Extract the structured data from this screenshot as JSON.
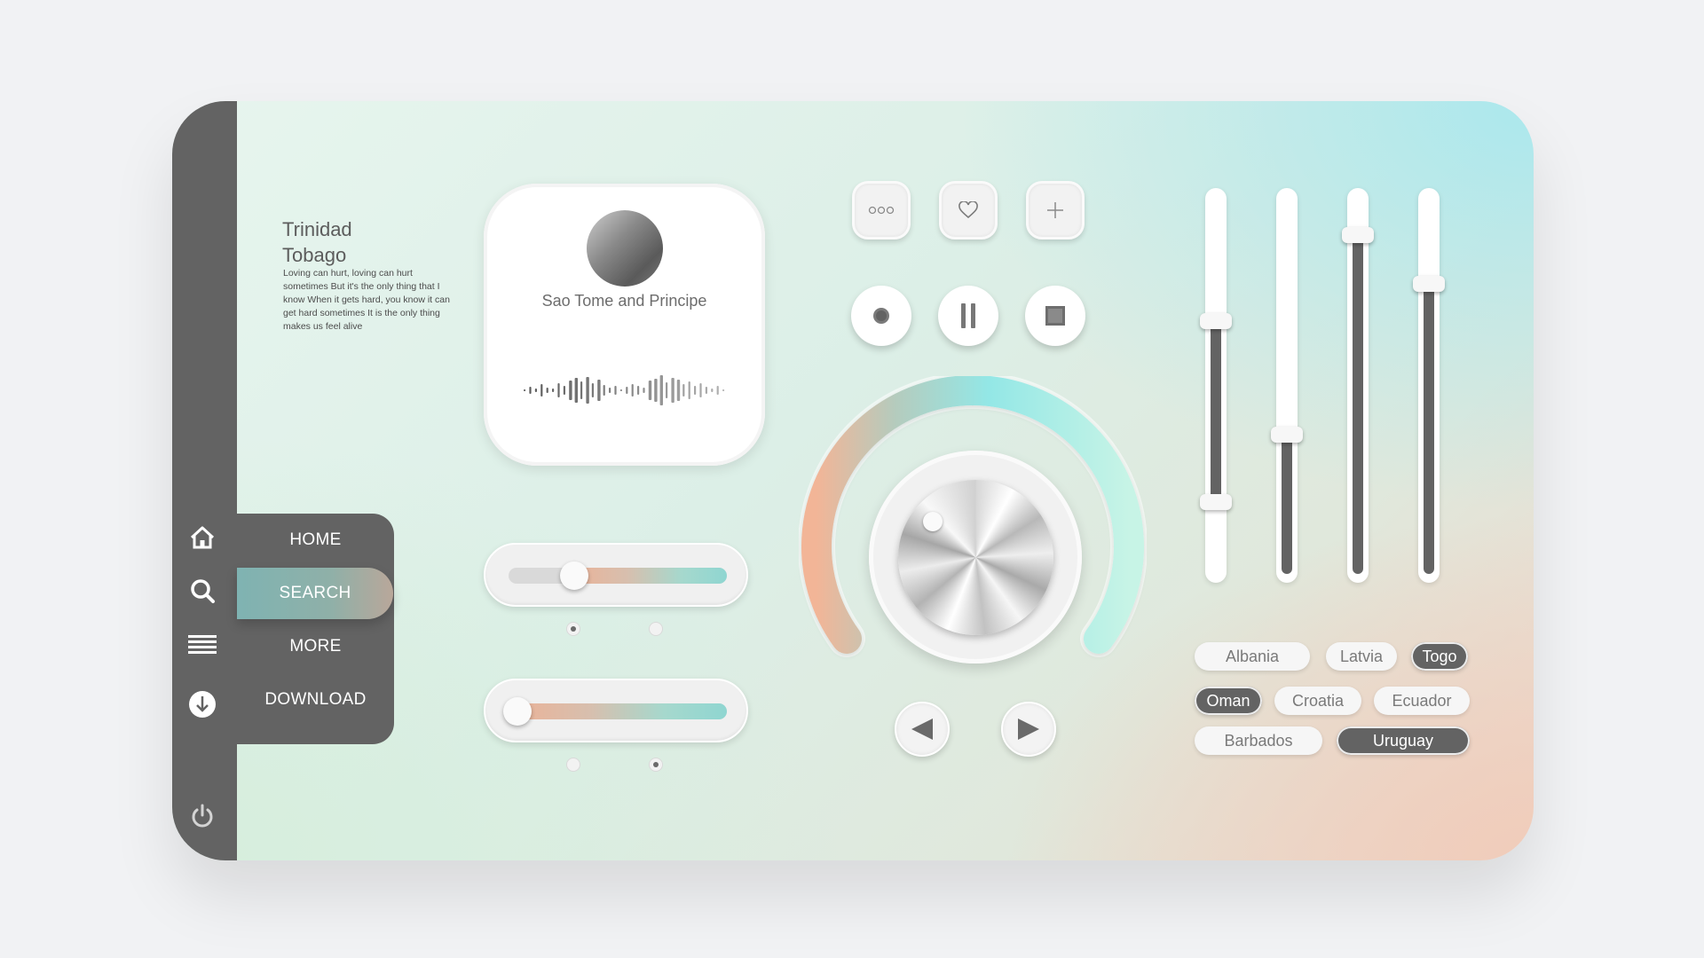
{
  "sidebar": {
    "icons": [
      {
        "icon": "home-icon"
      },
      {
        "icon": "search-icon"
      },
      {
        "icon": "menu-icon"
      },
      {
        "icon": "download-icon"
      }
    ],
    "power_icon": "power-icon"
  },
  "menu": {
    "items": [
      {
        "label": "HOME"
      },
      {
        "label": "SEARCH"
      },
      {
        "label": "MORE"
      },
      {
        "label": "DOWNLOAD"
      }
    ],
    "active_index": 1
  },
  "info": {
    "title_line1": "Trinidad",
    "title_line2": "Tobago",
    "lyrics": "Loving can hurt, loving can hurt sometimes But it's the only thing that I know When it gets hard, you know it can get hard sometimes It is the only thing makes us feel alive"
  },
  "player": {
    "title": "Sao Tome and Principe"
  },
  "sliders": [
    {
      "value_percent": 30
    },
    {
      "value_percent": 4
    }
  ],
  "slider_dots": [
    {
      "active": 0
    },
    {
      "active": 1
    }
  ],
  "controls": {
    "top_buttons": [
      "more-icon",
      "heart-icon",
      "plus-icon"
    ],
    "media_buttons": [
      "record-icon",
      "pause-icon",
      "stop-icon"
    ],
    "nav_buttons": [
      "previous-icon",
      "next-icon"
    ]
  },
  "colors": {
    "dark": "#636363",
    "accent_teal": "#8fd6d1",
    "accent_peach": "#eab399"
  },
  "vertical_sliders": [
    {
      "levels": [
        0.67,
        0.19
      ]
    },
    {
      "levels": [
        0.37
      ]
    },
    {
      "levels": [
        0.9
      ]
    },
    {
      "levels": [
        0.77
      ]
    }
  ],
  "tags": [
    {
      "label": "Albania",
      "style": "light"
    },
    {
      "label": "Latvia",
      "style": "light"
    },
    {
      "label": "Togo",
      "style": "dark"
    },
    {
      "label": "Oman",
      "style": "dark"
    },
    {
      "label": "Croatia",
      "style": "light"
    },
    {
      "label": "Ecuador",
      "style": "light"
    },
    {
      "label": "Barbados",
      "style": "light"
    },
    {
      "label": "Uruguay",
      "style": "dark"
    }
  ]
}
